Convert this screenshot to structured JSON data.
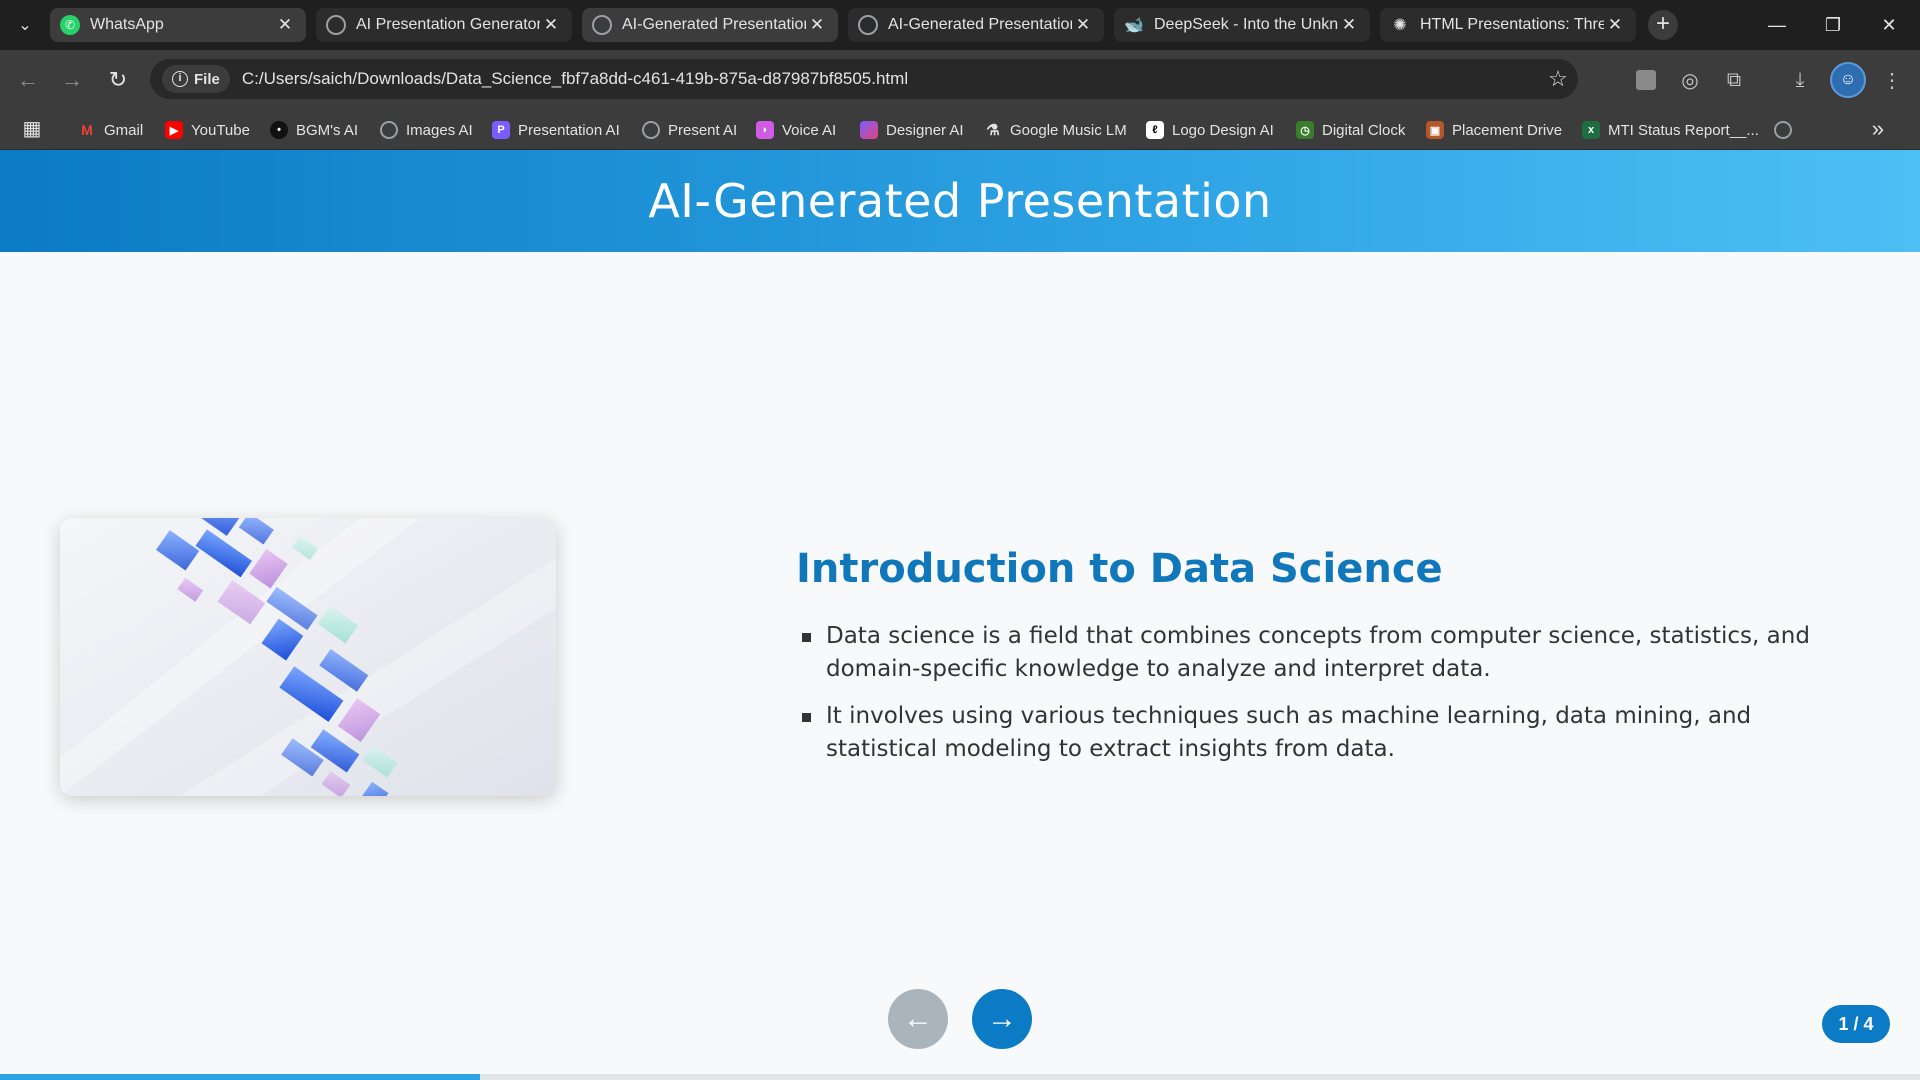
{
  "browser": {
    "tabs": [
      {
        "title": "WhatsApp",
        "icon": "whatsapp-icon",
        "color": "#25d366"
      },
      {
        "title": "AI Presentation Generator",
        "icon": "globe-icon",
        "color": "#9aa0a6"
      },
      {
        "title": "AI-Generated Presentation",
        "icon": "globe-icon",
        "color": "#9aa0a6"
      },
      {
        "title": "AI-Generated Presentation",
        "icon": "globe-icon",
        "color": "#9aa0a6"
      },
      {
        "title": "DeepSeek - Into the Unkno",
        "icon": "deepseek-icon",
        "color": "#4d6bfe"
      },
      {
        "title": "HTML Presentations: Three",
        "icon": "openai-icon",
        "color": "#e3e3e3"
      }
    ],
    "address": {
      "chip_label": "File",
      "url": "C:/Users/saich/Downloads/Data_Science_fbf7a8dd-c461-419b-875a-d87987bf8505.html"
    },
    "bookmarks": [
      {
        "label": "Gmail",
        "icon": "gmail-icon",
        "color": "#ea4335"
      },
      {
        "label": "YouTube",
        "icon": "youtube-icon",
        "color": "#ff0000"
      },
      {
        "label": "BGM's AI",
        "icon": "bgm-icon",
        "color": "#111111"
      },
      {
        "label": "Images AI",
        "icon": "globe-icon",
        "color": "#9aa0a6"
      },
      {
        "label": "Presentation AI",
        "icon": "presentation-icon",
        "color": "#7b5cff"
      },
      {
        "label": "Present AI",
        "icon": "globe-icon",
        "color": "#9aa0a6"
      },
      {
        "label": "Voice AI",
        "icon": "voice-icon",
        "color": "#d05ce3"
      },
      {
        "label": "Designer AI",
        "icon": "designer-icon",
        "color": "#e0457b"
      },
      {
        "label": "Google Music LM",
        "icon": "flask-icon",
        "color": "#e3e3e3"
      },
      {
        "label": "Logo Design AI",
        "icon": "logo-design-icon",
        "color": "#ffffff"
      },
      {
        "label": "Digital Clock",
        "icon": "clock-icon",
        "color": "#3a7d2c"
      },
      {
        "label": "Placement Drive",
        "icon": "placement-icon",
        "color": "#b5562b"
      },
      {
        "label": "MTI Status Report__...",
        "icon": "excel-icon",
        "color": "#1d6f42"
      }
    ]
  },
  "presentation": {
    "header_title": "AI-Generated Presentation",
    "slide": {
      "title": "Introduction to Data Science",
      "bullets": [
        "Data science is a field that combines concepts from computer science, statistics, and domain-specific knowledge to analyze and interpret data.",
        "It involves using various techniques such as machine learning, data mining, and statistical modeling to extract insights from data."
      ]
    },
    "nav": {
      "prev_label": "←",
      "next_label": "→",
      "counter": "1 / 4"
    },
    "progress": {
      "current": 1,
      "total": 4,
      "fraction": 0.25
    },
    "colors": {
      "accent": "#0a7bc4",
      "header_end": "#4cc0f5",
      "title": "#1177bb"
    }
  }
}
